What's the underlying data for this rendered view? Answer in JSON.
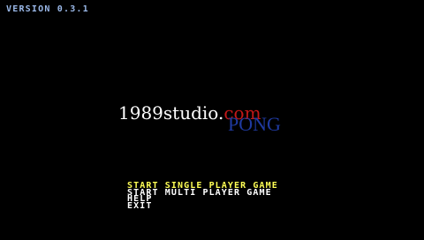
{
  "version_label": "VERSION 0.3.1",
  "logo": {
    "name": "1989studio.",
    "tld": "com",
    "game": "PONG"
  },
  "menu": {
    "items": [
      {
        "label": "START SINGLE PLAYER GAME",
        "selected": true
      },
      {
        "label": "START MULTI PLAYER GAME",
        "selected": false
      },
      {
        "label": "HELP",
        "selected": false
      },
      {
        "label": "EXIT",
        "selected": false
      }
    ]
  },
  "colors": {
    "background": "#000000",
    "version_text": "#9ab8e8",
    "menu_text": "#ffffff",
    "menu_selected": "#ffff55",
    "logo_tld": "#c01818",
    "logo_pong": "#1f3aa0"
  }
}
